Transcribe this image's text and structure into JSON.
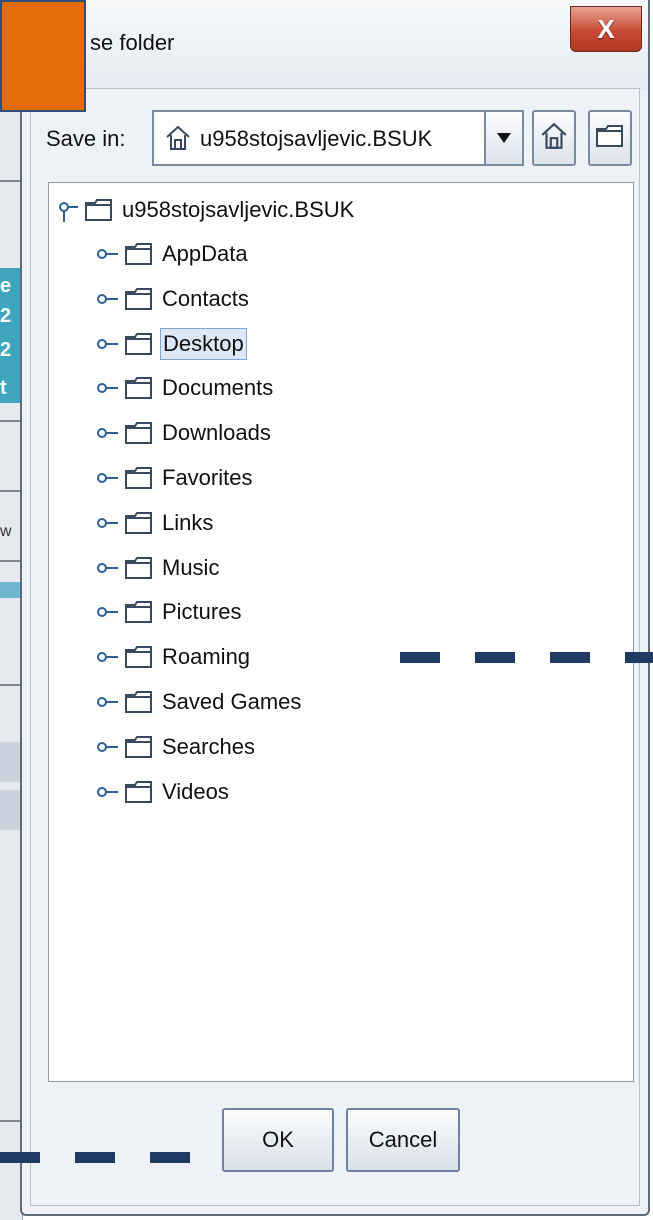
{
  "dialog": {
    "title": "Choose folder",
    "title_visible": "se folder",
    "close_glyph": "X"
  },
  "save_in": {
    "label": "Save in:",
    "value": "u958stojsavljevic.BSUK"
  },
  "tree": {
    "root": "u958stojsavljevic.BSUK",
    "children": [
      {
        "label": "AppData"
      },
      {
        "label": "Contacts"
      },
      {
        "label": "Desktop",
        "selected": true
      },
      {
        "label": "Documents"
      },
      {
        "label": "Downloads"
      },
      {
        "label": "Favorites"
      },
      {
        "label": "Links"
      },
      {
        "label": "Music"
      },
      {
        "label": "Pictures"
      },
      {
        "label": "Roaming"
      },
      {
        "label": "Saved Games"
      },
      {
        "label": "Searches"
      },
      {
        "label": "Videos"
      }
    ]
  },
  "buttons": {
    "ok": "OK",
    "cancel": "Cancel"
  },
  "background_app": {
    "fragments": [
      "e",
      "2",
      "2",
      "t",
      "w"
    ]
  },
  "colors": {
    "annotation_orange": "#e36c09",
    "annotation_dash": "#1f3b64",
    "selection_fill": "#dce8f6",
    "close_button_red": "#c74a34"
  },
  "icons": {
    "home": "home-icon",
    "new_folder": "new-folder-icon",
    "folder": "folder-icon",
    "dropdown": "chevron-down-icon",
    "tree_handle": "tree-handle-icon"
  }
}
